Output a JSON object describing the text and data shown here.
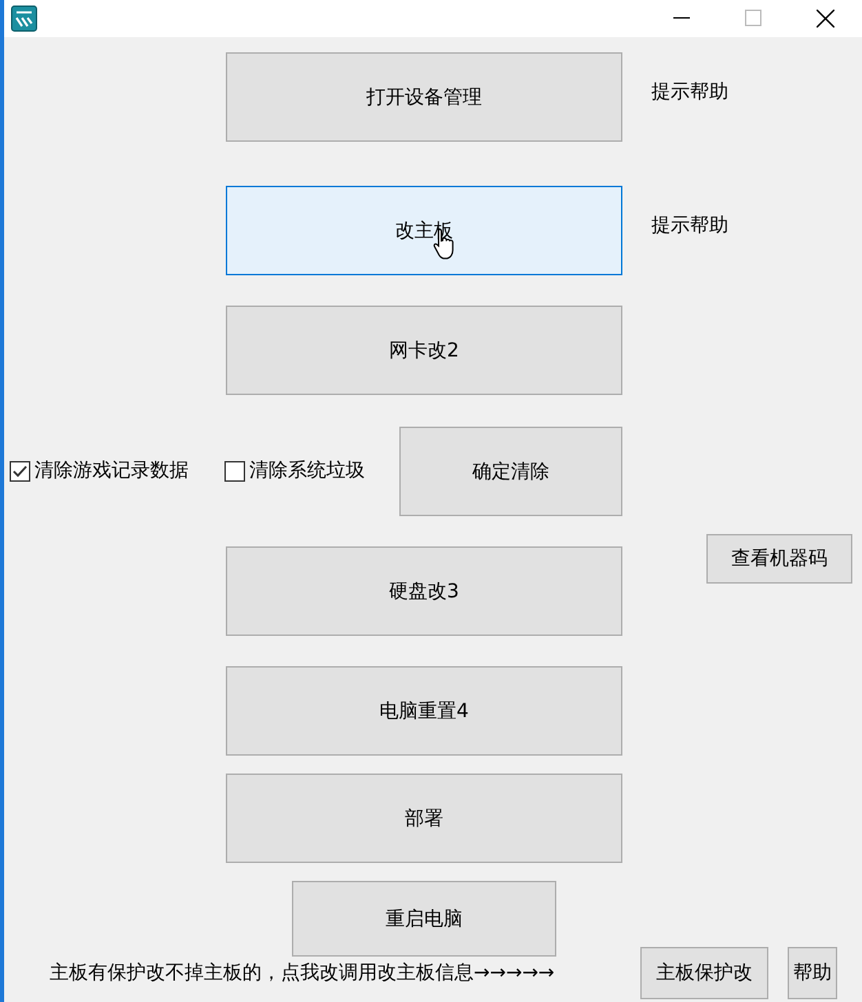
{
  "controls": [
    {
      "kind": "button",
      "label": "打开设备管理",
      "hovered": false
    },
    {
      "kind": "label",
      "label": "提示帮助"
    },
    {
      "kind": "button",
      "label": "改主板",
      "hovered": true
    },
    {
      "kind": "label",
      "label": "提示帮助"
    },
    {
      "kind": "button",
      "label": "网卡改2",
      "hovered": false
    },
    {
      "kind": "checkbox",
      "label": "清除游戏记录数据",
      "checked": true
    },
    {
      "kind": "checkbox",
      "label": "清除系统垃圾",
      "checked": false
    },
    {
      "kind": "button",
      "label": "确定清除",
      "hovered": false
    },
    {
      "kind": "button",
      "label": "查看机器码",
      "hovered": false
    },
    {
      "kind": "button",
      "label": "硬盘改3",
      "hovered": false
    },
    {
      "kind": "button",
      "label": "电脑重置4",
      "hovered": false
    },
    {
      "kind": "button",
      "label": "部署",
      "hovered": false
    },
    {
      "kind": "button",
      "label": "重启电脑",
      "hovered": false
    },
    {
      "kind": "label",
      "label": "主板有保护改不掉主板的，点我改调用改主板信息→→→→→"
    },
    {
      "kind": "button",
      "label": "主板保护改",
      "hovered": false
    },
    {
      "kind": "button",
      "label": "帮助",
      "hovered": false
    }
  ]
}
